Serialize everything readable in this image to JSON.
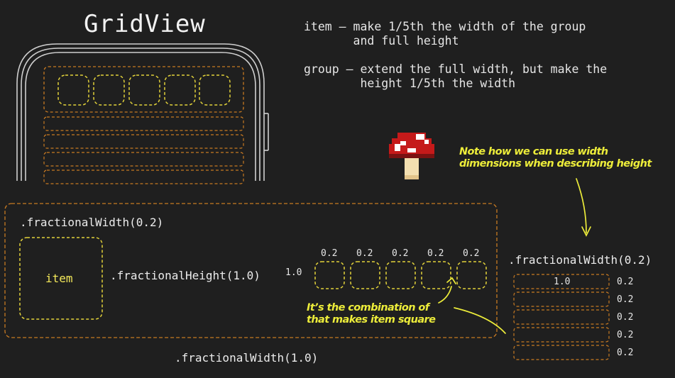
{
  "title": "GridView",
  "descriptions": {
    "item": "item – make 1/5th the width of the group\n       and full height",
    "group": "group – extend the full width, but make the\n        height 1/5th the width"
  },
  "labels": {
    "item_width": ".fractionalWidth(0.2)",
    "item": "item",
    "item_height": ".fractionalHeight(1.0)",
    "row_height": "1.0",
    "item_fractions": [
      "0.2",
      "0.2",
      "0.2",
      "0.2",
      "0.2"
    ],
    "group_width": ".fractionalWidth(1.0)",
    "group_height": ".fractionalWidth(0.2)",
    "group_first_value": "1.0",
    "group_fractions": [
      "0.2",
      "0.2",
      "0.2",
      "0.2",
      "0.2"
    ]
  },
  "annotations": {
    "width_for_height": "Note how we can use width\ndimensions when describing height",
    "combination": "It’s the combination of\nthat makes item square"
  },
  "colors": {
    "background": "#1f1f1f",
    "group_outline": "#c87a22",
    "item_outline": "#e2d23a",
    "annotation": "#ecec3a",
    "device_outline": "#cfcfcf"
  }
}
